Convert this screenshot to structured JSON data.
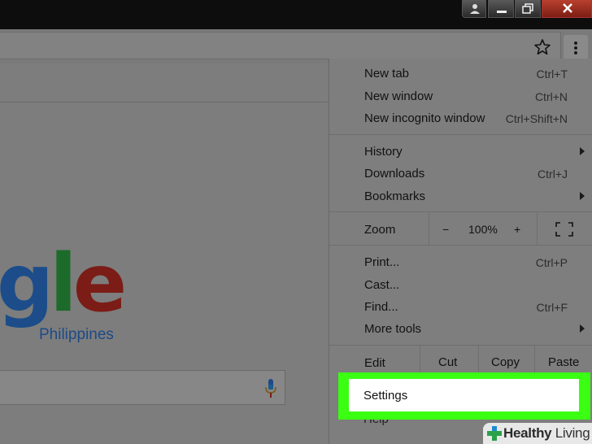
{
  "browser": {
    "menu_button_label": "⋮"
  },
  "google": {
    "logo_text": "gle",
    "region": "Philippines"
  },
  "menu": {
    "group1": [
      {
        "label": "New tab",
        "shortcut": "Ctrl+T"
      },
      {
        "label": "New window",
        "shortcut": "Ctrl+N"
      },
      {
        "label": "New incognito window",
        "shortcut": "Ctrl+Shift+N"
      }
    ],
    "group2": [
      {
        "label": "History",
        "submenu": true
      },
      {
        "label": "Downloads",
        "shortcut": "Ctrl+J"
      },
      {
        "label": "Bookmarks",
        "submenu": true
      }
    ],
    "zoom": {
      "label": "Zoom",
      "minus": "−",
      "value": "100%",
      "plus": "+"
    },
    "group3": [
      {
        "label": "Print...",
        "shortcut": "Ctrl+P"
      },
      {
        "label": "Cast..."
      },
      {
        "label": "Find...",
        "shortcut": "Ctrl+F"
      },
      {
        "label": "More tools",
        "submenu": true
      }
    ],
    "edit": {
      "label": "Edit",
      "cut": "Cut",
      "copy": "Copy",
      "paste": "Paste"
    },
    "settings": "Settings",
    "help_peek": "Help"
  },
  "watermark": {
    "brand_bold": "Healthy",
    "brand_rest": " Living"
  },
  "colors": {
    "highlight": "#3bff12",
    "logo_blue": "#1c4d8a",
    "logo_green": "#1d6b2a",
    "logo_red": "#7b1c16"
  }
}
